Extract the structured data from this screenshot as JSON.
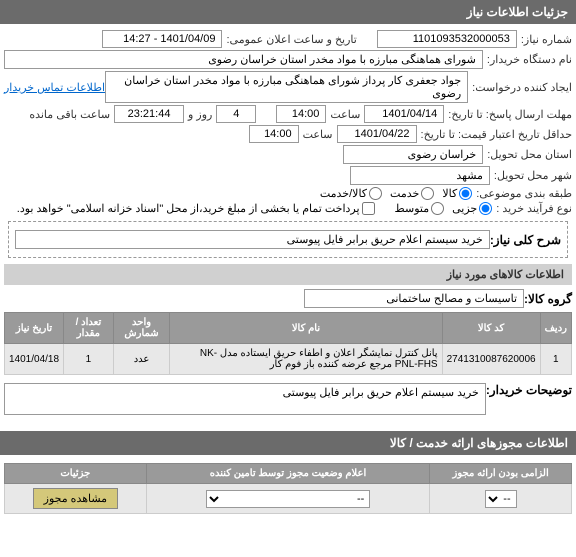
{
  "header": {
    "title": "جزئیات اطلاعات نیاز"
  },
  "fields": {
    "need_number_label": "شماره نیاز:",
    "need_number": "1101093532000053",
    "announce_date_label": "تاریخ و ساعت اعلان عمومی:",
    "announce_date": "1401/04/09 - 14:27",
    "buyer_label": "نام دستگاه خریدار:",
    "buyer": "شورای هماهنگی مبارزه با مواد مخدر استان خراسان رضوی",
    "creator_label": "ایجاد کننده درخواست:",
    "creator": "جواد جعفری کار پرداز شورای هماهنگی مبارزه با مواد مخدر استان خراسان رضوی",
    "contact_link": "اطلاعات تماس خریدار",
    "deadline_from_label": "مهلت ارسال پاسخ: تا تاریخ:",
    "deadline_date": "1401/04/14",
    "deadline_time_label": "ساعت",
    "deadline_time": "14:00",
    "day_count": "4",
    "day_label": "روز و",
    "remaining_time": "23:21:44",
    "remaining_label": "ساعت باقی مانده",
    "min_validity_label": "حداقل تاریخ اعتبار قیمت: تا تاریخ:",
    "min_validity_date": "1401/04/22",
    "min_validity_time": "14:00",
    "province_label": "استان محل تحویل:",
    "province": "خراسان رضوی",
    "city_label": "شهر محل تحویل:",
    "city": "مشهد",
    "category_label": "طبقه بندی موضوعی:",
    "cat_goods": "کالا",
    "cat_service": "خدمت",
    "cat_goods_service": "کالا/خدمت",
    "process_label": "نوع فرآیند خرید :",
    "proc_partial": "جزیی",
    "proc_medium": "متوسط",
    "payment_note": "پرداخت تمام یا بخشی از مبلغ خرید،از محل \"اسناد خزانه اسلامی\" خواهد بود."
  },
  "summary": {
    "need_desc_label": "شرح کلی نیاز:",
    "need_desc": "خرید سیستم اعلام حریق برابر فایل پیوستی"
  },
  "goods_section": {
    "title": "اطلاعات کالاهای مورد نیاز",
    "group_label": "گروه کالا:",
    "group": "تاسیسات و مصالح ساختمانی",
    "columns": {
      "row": "ردیف",
      "code": "کد کالا",
      "name": "نام کالا",
      "unit": "واحد شمارش",
      "qty": "تعداد / مقدار",
      "need_date": "تاریخ نیاز"
    },
    "items": [
      {
        "row": "1",
        "code": "2741310087620006",
        "name": "پانل کنترل نمایشگر اعلان و اطفاء حریق ایستاده مدل -NK PNL-FHS مرجع عرضه کننده باز فوم کار",
        "unit": "عدد",
        "qty": "1",
        "need_date": "1401/04/18"
      }
    ],
    "buyer_notes_label": "توضیحات خریدار:",
    "buyer_notes": "خرید سیستم اعلام حریق برابر فایل پیوستی"
  },
  "service_section": {
    "title": "اطلاعات مجوزهای ارائه خدمت / کالا",
    "columns": {
      "required": "الزامی بودن ارائه مجوز",
      "status": "اعلام وضعیت مجوز توسط تامین کننده",
      "details": "جزئیات"
    },
    "row": {
      "required_placeholder": "--",
      "status_placeholder": "--",
      "details_btn": "مشاهده مجوز"
    }
  }
}
